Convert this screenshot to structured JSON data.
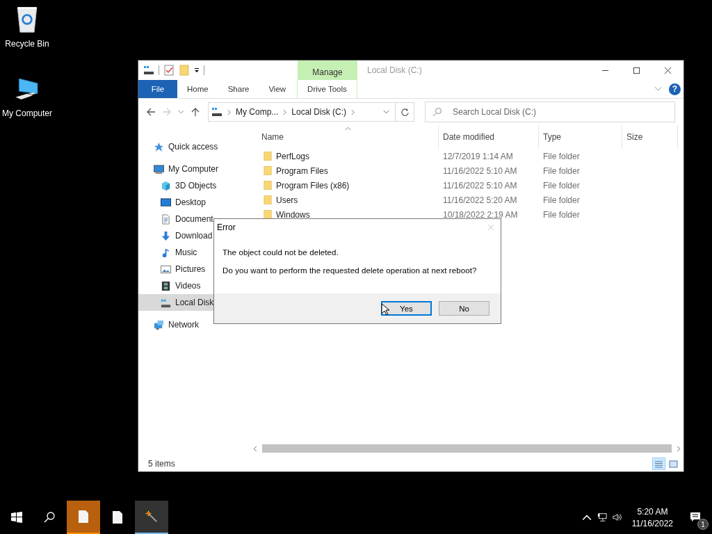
{
  "desktop": {
    "icons": [
      {
        "label": "Recycle Bin"
      },
      {
        "label": "My Computer"
      }
    ]
  },
  "explorer": {
    "context_group": "Manage",
    "title": "Local Disk (C:)",
    "help_button": "?",
    "ribbon_tabs": [
      {
        "label": "File",
        "kind": "file"
      },
      {
        "label": "Home",
        "kind": "tab"
      },
      {
        "label": "Share",
        "kind": "tab"
      },
      {
        "label": "View",
        "kind": "tab"
      },
      {
        "label": "Drive Tools",
        "kind": "context"
      }
    ],
    "breadcrumb": [
      "My Comp...",
      "Local Disk (C:)"
    ],
    "search": {
      "placeholder": "Search Local Disk (C:)"
    },
    "nav_pane": [
      {
        "label": "Quick access",
        "selected": false
      },
      {
        "label": "My Computer",
        "selected": false,
        "children": [
          {
            "label": "3D Objects",
            "selected": false
          },
          {
            "label": "Desktop",
            "selected": false
          },
          {
            "label": "Document",
            "selected": false
          },
          {
            "label": "Download",
            "selected": false
          },
          {
            "label": "Music",
            "selected": false
          },
          {
            "label": "Pictures",
            "selected": false
          },
          {
            "label": "Videos",
            "selected": false
          },
          {
            "label": "Local Disk",
            "selected": true
          }
        ]
      },
      {
        "label": "Network",
        "selected": false
      }
    ],
    "columns": [
      "Name",
      "Date modified",
      "Type",
      "Size"
    ],
    "rows": [
      {
        "name": "PerfLogs",
        "date_modified": "12/7/2019 1:14 AM",
        "type": "File folder"
      },
      {
        "name": "Program Files",
        "date_modified": "11/16/2022 5:10 AM",
        "type": "File folder"
      },
      {
        "name": "Program Files (x86)",
        "date_modified": "11/16/2022 5:10 AM",
        "type": "File folder"
      },
      {
        "name": "Users",
        "date_modified": "11/16/2022 5:20 AM",
        "type": "File folder"
      },
      {
        "name": "Windows",
        "date_modified": "10/18/2022 2:19 AM",
        "type": "File folder"
      }
    ],
    "status": "5 items",
    "views": [
      {
        "selected": true
      },
      {
        "selected": false
      }
    ]
  },
  "dialog": {
    "title": "Error",
    "message": "The object could not be deleted.",
    "question": "Do you want to perform the requested delete operation at next reboot?",
    "buttons": [
      {
        "label": "Yes",
        "selected": true
      },
      {
        "label": "No",
        "selected": false
      }
    ]
  },
  "taskbar": {
    "apps": [
      {
        "attention": true,
        "active": false
      },
      {
        "attention": false,
        "active": false
      },
      {
        "attention": false,
        "active": true
      }
    ],
    "time": "5:20 AM",
    "date": "11/16/2022",
    "notification_count": "1"
  }
}
